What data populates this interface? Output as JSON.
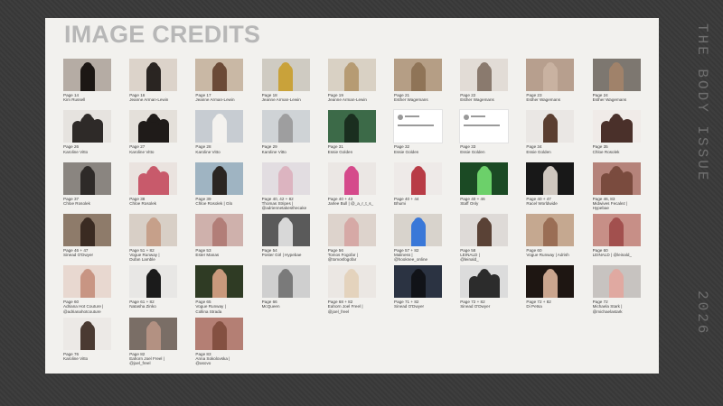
{
  "page": {
    "title": "IMAGE CREDITS",
    "side_label": "THE BODY ISSUE",
    "year": "2026"
  },
  "credits": [
    {
      "lines": [
        "Page 14",
        "Kim Russell"
      ],
      "bg": "#b5aca4",
      "fig": "#1c1714"
    },
    {
      "lines": [
        "Page 16",
        "Jeanne Arman-Lewin"
      ],
      "bg": "#dcd3ca",
      "fig": "#2a2522"
    },
    {
      "lines": [
        "Page 17",
        "Jeanne Arman-Lewin"
      ],
      "bg": "#c9b8a5",
      "fig": "#6b4a37"
    },
    {
      "lines": [
        "Page 18",
        "Jeanne Arman-Lewin"
      ],
      "bg": "#cfcbc2",
      "fig": "#c9a23a"
    },
    {
      "lines": [
        "Page 19",
        "Jeanne Arman-Lewin"
      ],
      "bg": "#d9d1c4",
      "fig": "#b69b73"
    },
    {
      "lines": [
        "Page 21",
        "Esther Wagemans"
      ],
      "bg": "#b59e85",
      "fig": "#8f7457"
    },
    {
      "lines": [
        "Page 22",
        "Esther Wagemans"
      ],
      "bg": "#e2dcd6",
      "fig": "#8a7a6e"
    },
    {
      "lines": [
        "Page 23",
        "Esther Wagemans"
      ],
      "bg": "#b79f8e",
      "fig": "#c9b2a1"
    },
    {
      "lines": [
        "Page 24",
        "Esther Wagemans"
      ],
      "bg": "#7d7770",
      "fig": "#a0826a"
    },
    {
      "lines": [
        "Page 26",
        "Karoline Vitto"
      ],
      "bg": "#e6e3df",
      "fig": "#2e2a28",
      "multi": true
    },
    {
      "lines": [
        "Page 27",
        "Karoline Vitto"
      ],
      "bg": "#e4e0da",
      "fig": "#1f1b19",
      "multi": true
    },
    {
      "lines": [
        "Page 28",
        "Karoline Vitto"
      ],
      "bg": "#c7ccd2",
      "fig": "#f4f2ef"
    },
    {
      "lines": [
        "Page 29",
        "Karoline Vitto"
      ],
      "bg": "#cfd3d6",
      "fig": "#9e9e9f"
    },
    {
      "lines": [
        "Page 31",
        "Essie Golden"
      ],
      "bg": "#3c6a48",
      "fig": "#1a2e1f"
    },
    {
      "lines": [
        "Page 32",
        "Essie Golden"
      ],
      "screen": true,
      "text": [
        "realajadian ✓",
        "Make sure you remind people again!"
      ]
    },
    {
      "lines": [
        "Page 33",
        "Essie Golden"
      ],
      "screen": true,
      "text": [
        "realajadian ✓",
        "instagram post caption text shown here"
      ]
    },
    {
      "lines": [
        "Page 34",
        "Essie Golden"
      ],
      "bg": "#eae7e4",
      "fig": "#5a3e30"
    },
    {
      "lines": [
        "Page 35",
        "Chloe Rosolek"
      ],
      "bg": "#f0ebe8",
      "fig": "#4a302a",
      "multi": true
    },
    {
      "lines": [
        "Page 37",
        "Chloe Rosolek"
      ],
      "bg": "#8a8580",
      "fig": "#2e2a28"
    },
    {
      "lines": [
        "Page 38",
        "Chloe Rosolek"
      ],
      "bg": "#eae3df",
      "fig": "#c85a6b",
      "multi": true
    },
    {
      "lines": [
        "Page 39",
        "Chloe Rosolek | Glo"
      ],
      "bg": "#9fb4c2",
      "fig": "#2b2622"
    },
    {
      "lines": [
        "Page 40, 42 + 82",
        "Thomas Stripes |",
        "@adriennetakesthecake"
      ],
      "bg": "#e2dde1",
      "fig": "#dcb4c0"
    },
    {
      "lines": [
        "Page 40 + 43",
        "Jarlee Bull | @_a_r_t_s_"
      ],
      "bg": "#ebe7e4",
      "fig": "#d54a8b"
    },
    {
      "lines": [
        "Page 40 + 44",
        "Bhumi"
      ],
      "bg": "#eeeae8",
      "fig": "#b83c46"
    },
    {
      "lines": [
        "Page 40 + 46",
        "Staff Only"
      ],
      "bg": "#1b4a24",
      "fig": "#6cd06a"
    },
    {
      "lines": [
        "Page 40 + 47",
        "Racel Worldwide"
      ],
      "bg": "#181818",
      "fig": "#cfc7bf"
    },
    {
      "lines": [
        "Page 46, 83",
        "Midwives Fecalez |",
        "Hypebae"
      ],
      "bg": "#b5837a",
      "fig": "#7a4b3e",
      "multi": true
    },
    {
      "lines": [
        "Page 46 + 47",
        "Sinead O'Dwyer"
      ],
      "bg": "#8e7b6a",
      "fig": "#3a2b22"
    },
    {
      "lines": [
        "Page 51 + 82",
        "Vogue Runway |",
        "Dufan Lamble"
      ],
      "bg": "#d8cfc6",
      "fig": "#c6a08a"
    },
    {
      "lines": [
        "Page 53",
        "Ester Manas"
      ],
      "bg": "#cfb1ac",
      "fig": "#b27e78"
    },
    {
      "lines": [
        "Page 54",
        "Poster Girl | Hypebae"
      ],
      "bg": "#5a5a5a",
      "fig": "#d8d8d8"
    },
    {
      "lines": [
        "Page 56",
        "Tomos Fogofar |",
        "@tomosfogofar"
      ],
      "bg": "#ddd3cc",
      "fig": "#d6a9a6"
    },
    {
      "lines": [
        "Page 57 + 82",
        "Maliness |",
        "@hooknee_online"
      ],
      "bg": "#d8d3cc",
      "fig": "#3a78d8"
    },
    {
      "lines": [
        "Page 58",
        "LEINALD |",
        "@leinald_"
      ],
      "bg": "#dedad7",
      "fig": "#5a4236"
    },
    {
      "lines": [
        "Page 60",
        "Vogue Runway | Adrish"
      ],
      "bg": "#c5a890",
      "fig": "#9a6e55"
    },
    {
      "lines": [
        "Page 60",
        "LEINALD | @leinald_"
      ],
      "bg": "#c78f87",
      "fig": "#a2504e"
    },
    {
      "lines": [
        "Page 60",
        "Adriana Hot Couture |",
        "@adrianahotcouture"
      ],
      "bg": "#e8d8d0",
      "fig": "#c89583"
    },
    {
      "lines": [
        "Page 61 + 82",
        "Natasha Zinko"
      ],
      "bg": "#e8e7e5",
      "fig": "#1b1b1b"
    },
    {
      "lines": [
        "Page 65",
        "Vogue Runway |",
        "Collina Strada"
      ],
      "bg": "#2f3b24",
      "fig": "#c9997c"
    },
    {
      "lines": [
        "Page 66",
        "McQueen"
      ],
      "bg": "#cfcfcf",
      "fig": "#7a7a7a"
    },
    {
      "lines": [
        "Page 68 + 82",
        "Eahorn Joel Freel |",
        "@joel_freel"
      ],
      "bg": "#ebe7e3",
      "fig": "#e4d3bd"
    },
    {
      "lines": [
        "Page 71 + 82",
        "Sinead O'Dwyer"
      ],
      "bg": "#2b3342",
      "fig": "#111318"
    },
    {
      "lines": [
        "Page 72 + 82",
        "Sinead O'Dwyer"
      ],
      "bg": "#dcdcdc",
      "fig": "#2c2c2c",
      "multi": true
    },
    {
      "lines": [
        "Page 72 + 82",
        "Di Petsa"
      ],
      "bg": "#1e1612",
      "fig": "#caa58e"
    },
    {
      "lines": [
        "Page 72",
        "Michaela Stark |",
        "@michaelastark"
      ],
      "bg": "#c7c3c0",
      "fig": "#e0a9a1"
    },
    {
      "lines": [
        "Page 76",
        "Karoline Vitto"
      ],
      "bg": "#ece9e6",
      "fig": "#4a3a32"
    },
    {
      "lines": [
        "Page 82",
        "Eahorn Joel Freel |",
        "@joel_freel"
      ],
      "bg": "#7a6e66",
      "fig": "#b39182"
    },
    {
      "lines": [
        "Page 83",
        "Anna Sokolovska |",
        "@asovo"
      ],
      "bg": "#b47f74",
      "fig": "#845041"
    }
  ]
}
